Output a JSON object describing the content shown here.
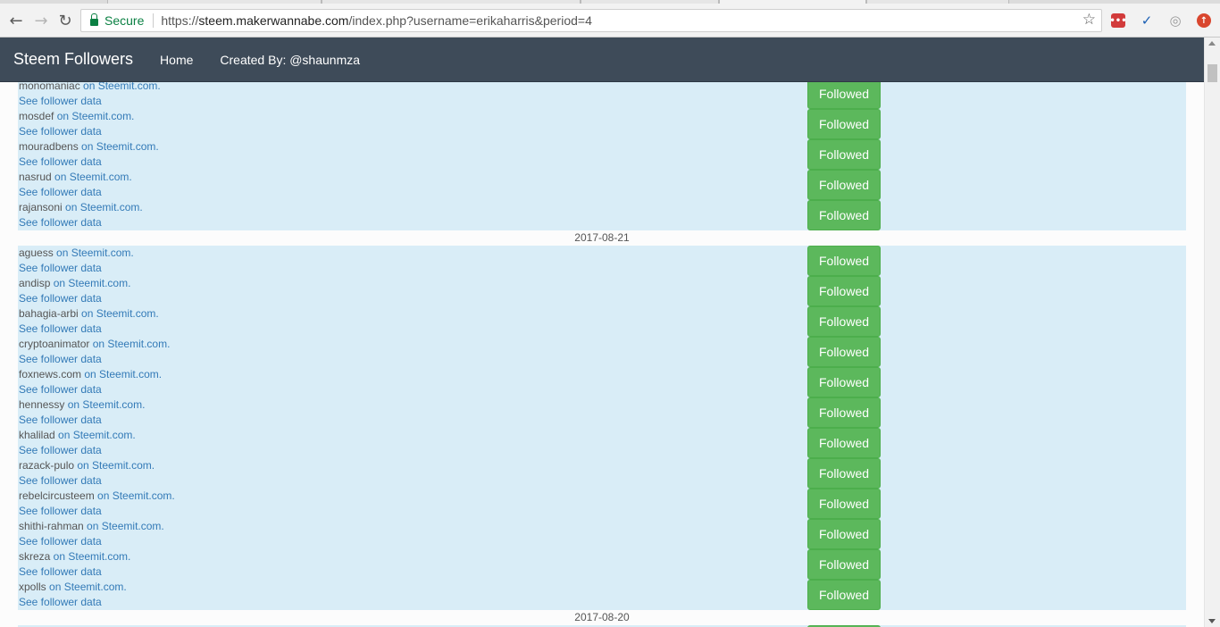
{
  "browser": {
    "secure_label": "Secure",
    "url_scheme": "https://",
    "url_host": "steem.makerwannabe.com",
    "url_path": "/index.php?username=erikaharris&period=4"
  },
  "navbar": {
    "brand": "Steem Followers",
    "home": "Home",
    "created_by": "Created By: @shaunmza"
  },
  "on_label": " on Steemit.com.",
  "see_data_label": "See follower data",
  "button_label": "Followed",
  "groups": [
    {
      "followers": [
        "monomaniac",
        "mosdef",
        "mouradbens",
        "nasrud",
        "rajansoni"
      ]
    },
    {
      "date": "2017-08-21",
      "followers": [
        "aguess",
        "andisp",
        "bahagia-arbi",
        "cryptoanimator",
        "foxnews.com",
        "hennessy",
        "khalilad",
        "razack-pulo",
        "rebelcircusteem",
        "shithi-rahman",
        "skreza",
        "xpolls"
      ]
    },
    {
      "date": "2017-08-20",
      "followers": [
        ""
      ]
    }
  ]
}
